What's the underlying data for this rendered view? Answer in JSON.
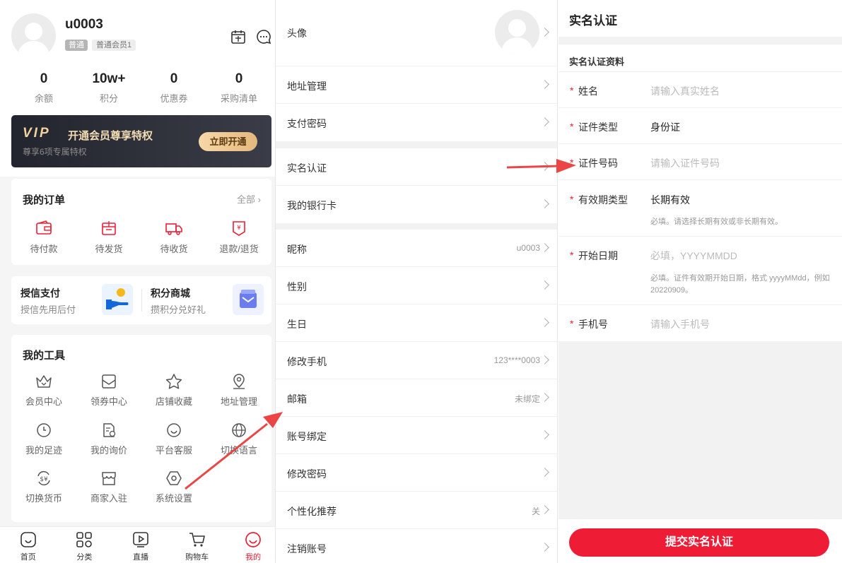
{
  "profile": {
    "username": "u0003",
    "badge_level": "普通",
    "badge_member": "普通会员1",
    "stats": [
      {
        "value": "0",
        "label": "余额"
      },
      {
        "value": "10w+",
        "label": "积分"
      },
      {
        "value": "0",
        "label": "优惠券"
      },
      {
        "value": "0",
        "label": "采购清单"
      }
    ],
    "vip": {
      "logo": "VIP",
      "title": "开通会员尊享特权",
      "subtitle": "尊享6项专属特权",
      "button": "立即开通"
    },
    "orders": {
      "title": "我的订单",
      "more": "全部",
      "items": [
        {
          "label": "待付款",
          "icon": "wallet-icon"
        },
        {
          "label": "待发货",
          "icon": "package-icon"
        },
        {
          "label": "待收货",
          "icon": "truck-icon"
        },
        {
          "label": "退款/退货",
          "icon": "refund-icon"
        }
      ]
    },
    "credit": {
      "title": "授信支付",
      "subtitle": "授信先用后付"
    },
    "points_mall": {
      "title": "积分商城",
      "subtitle": "攒积分兑好礼"
    },
    "tools": {
      "title": "我的工具",
      "items": [
        {
          "label": "会员中心",
          "icon": "crown-icon"
        },
        {
          "label": "领券中心",
          "icon": "coupon-icon"
        },
        {
          "label": "店铺收藏",
          "icon": "star-icon"
        },
        {
          "label": "地址管理",
          "icon": "location-icon"
        },
        {
          "label": "我的足迹",
          "icon": "clock-icon"
        },
        {
          "label": "我的询价",
          "icon": "inquiry-icon"
        },
        {
          "label": "平台客服",
          "icon": "service-icon"
        },
        {
          "label": "切换语言",
          "icon": "globe-icon"
        },
        {
          "label": "切换货币",
          "icon": "currency-icon"
        },
        {
          "label": "商家入驻",
          "icon": "shop-icon"
        },
        {
          "label": "系统设置",
          "icon": "settings-icon"
        }
      ]
    },
    "tabbar": [
      {
        "label": "首页",
        "icon": "home-icon"
      },
      {
        "label": "分类",
        "icon": "category-icon"
      },
      {
        "label": "直播",
        "icon": "live-icon"
      },
      {
        "label": "购物车",
        "icon": "cart-icon"
      },
      {
        "label": "我的",
        "icon": "mine-icon",
        "active": true
      }
    ]
  },
  "settings": {
    "avatar_label": "头像",
    "group1": [
      {
        "label": "地址管理",
        "value": ""
      },
      {
        "label": "支付密码",
        "value": ""
      }
    ],
    "group2": [
      {
        "label": "实名认证",
        "value": ""
      },
      {
        "label": "我的银行卡",
        "value": ""
      }
    ],
    "group3": [
      {
        "label": "昵称",
        "value": "u0003"
      },
      {
        "label": "性别",
        "value": ""
      },
      {
        "label": "生日",
        "value": ""
      },
      {
        "label": "修改手机",
        "value": "123****0003"
      },
      {
        "label": "邮箱",
        "value": "未绑定"
      },
      {
        "label": "账号绑定",
        "value": ""
      },
      {
        "label": "修改密码",
        "value": ""
      },
      {
        "label": "个性化推荐",
        "value": "关"
      },
      {
        "label": "注销账号",
        "value": ""
      }
    ]
  },
  "realname": {
    "title": "实名认证",
    "section": "实名认证资料",
    "fields": [
      {
        "label": "姓名",
        "placeholder": "请输入真实姓名"
      },
      {
        "label": "证件类型",
        "value": "身份证"
      },
      {
        "label": "证件号码",
        "placeholder": "请输入证件号码"
      },
      {
        "label": "有效期类型",
        "value": "长期有效",
        "hint": "必填。请选择长期有效或非长期有效。"
      },
      {
        "label": "开始日期",
        "placeholder": "必填，YYYYMMDD",
        "hint": "必填。证件有效期开始日期，格式 yyyyMMdd，例如 20220909。"
      },
      {
        "label": "手机号",
        "placeholder": "请输入手机号"
      }
    ],
    "submit": "提交实名认证",
    "required_mark": "*"
  },
  "colors": {
    "accent": "#ee1d35",
    "vip_gold": "#f2d3a1"
  }
}
